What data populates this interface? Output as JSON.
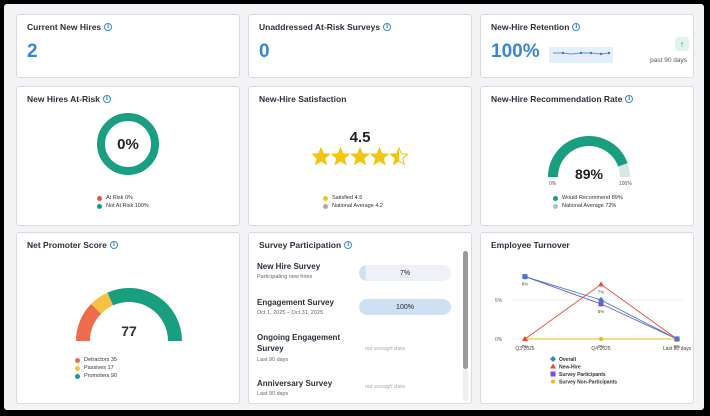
{
  "cards": {
    "current_new_hires": {
      "title": "Current New Hires",
      "value": "2"
    },
    "unaddressed": {
      "title": "Unaddressed At-Risk Surveys",
      "value": "0"
    },
    "retention": {
      "title": "New-Hire Retention",
      "value": "100%",
      "period": "past 90 days",
      "trend_icon": "arrow-up-icon"
    },
    "at_risk": {
      "title": "New Hires At-Risk",
      "center": "0%",
      "legend": [
        {
          "label": "At Risk 0%",
          "color": "#e8553e"
        },
        {
          "label": "Not At Risk 100%",
          "color": "#1a9e80"
        }
      ],
      "at_risk_fraction": 0
    },
    "satisfaction": {
      "title": "New-Hire Satisfaction",
      "score": "4.5",
      "rating": 4.5,
      "max": 5,
      "legend": [
        {
          "label": "Satisfied 4.5",
          "color": "#f2c511"
        },
        {
          "label": "National Average 4.2",
          "color": "#a9a9a9"
        }
      ]
    },
    "recommendation": {
      "title": "New-Hire Recommendation Rate",
      "value": "89%",
      "fraction": 0.89,
      "min_label": "0%",
      "max_label": "100%",
      "legend": [
        {
          "label": "Would Recommend 89%",
          "color": "#1a9e80"
        },
        {
          "label": "National Average 72%",
          "color": "#a8c7bd"
        }
      ]
    },
    "nps": {
      "title": "Net Promoter Score",
      "value": "77",
      "segments": [
        {
          "label": "Detractors 35",
          "count": 35,
          "color": "#ef6b4b"
        },
        {
          "label": "Passives 17",
          "count": 17,
          "color": "#f7c244"
        },
        {
          "label": "Promoters 90",
          "count": 90,
          "color": "#1a9e80"
        }
      ]
    },
    "participation": {
      "title": "Survey Participation",
      "surveys": [
        {
          "name": "New Hire Survey",
          "sub": "Participating new hires",
          "value": "7%",
          "fraction": 0.07
        },
        {
          "name": "Engagement Survey",
          "sub": "Oct 1, 2025 – Oct 31, 2025",
          "value": "100%",
          "fraction": 1.0
        },
        {
          "name": "Ongoing Engagement Survey",
          "sub": "Last 90 days",
          "value": "not enough data",
          "fraction": null
        },
        {
          "name": "Anniversary Survey",
          "sub": "Last 90 days",
          "value": "not enough data",
          "fraction": null
        }
      ]
    },
    "turnover": {
      "title": "Employee Turnover"
    }
  },
  "chart_data": {
    "type": "line",
    "categories": [
      "Q3 2025",
      "Q4 2025",
      "Last 90 days"
    ],
    "y_ticks": [
      "0%",
      "5%"
    ],
    "ylim": [
      0,
      10
    ],
    "series": [
      {
        "name": "Overall",
        "color": "#3b82c4",
        "marker": "diamond",
        "values": [
          8,
          5,
          0
        ]
      },
      {
        "name": "New-Hire",
        "color": "#ea4a3c",
        "marker": "triangle",
        "values": [
          0,
          7,
          0
        ]
      },
      {
        "name": "Survey Participants",
        "color": "#7b4fd6",
        "marker": "square",
        "values": [
          8,
          4.5,
          0
        ]
      },
      {
        "name": "Survey Non-Participants",
        "color": "#f2b90f",
        "marker": "star",
        "values": [
          0,
          0,
          0
        ]
      }
    ],
    "point_labels": [
      {
        "series": 0,
        "index": 0,
        "text": "8%"
      },
      {
        "series": 1,
        "index": 0,
        "text": "0%"
      },
      {
        "series": 1,
        "index": 1,
        "text": "7%"
      },
      {
        "series": 2,
        "index": 1,
        "text": "5%"
      },
      {
        "series": 3,
        "index": 1,
        "text": "0%"
      },
      {
        "series": 0,
        "index": 2,
        "text": "0%"
      }
    ]
  }
}
